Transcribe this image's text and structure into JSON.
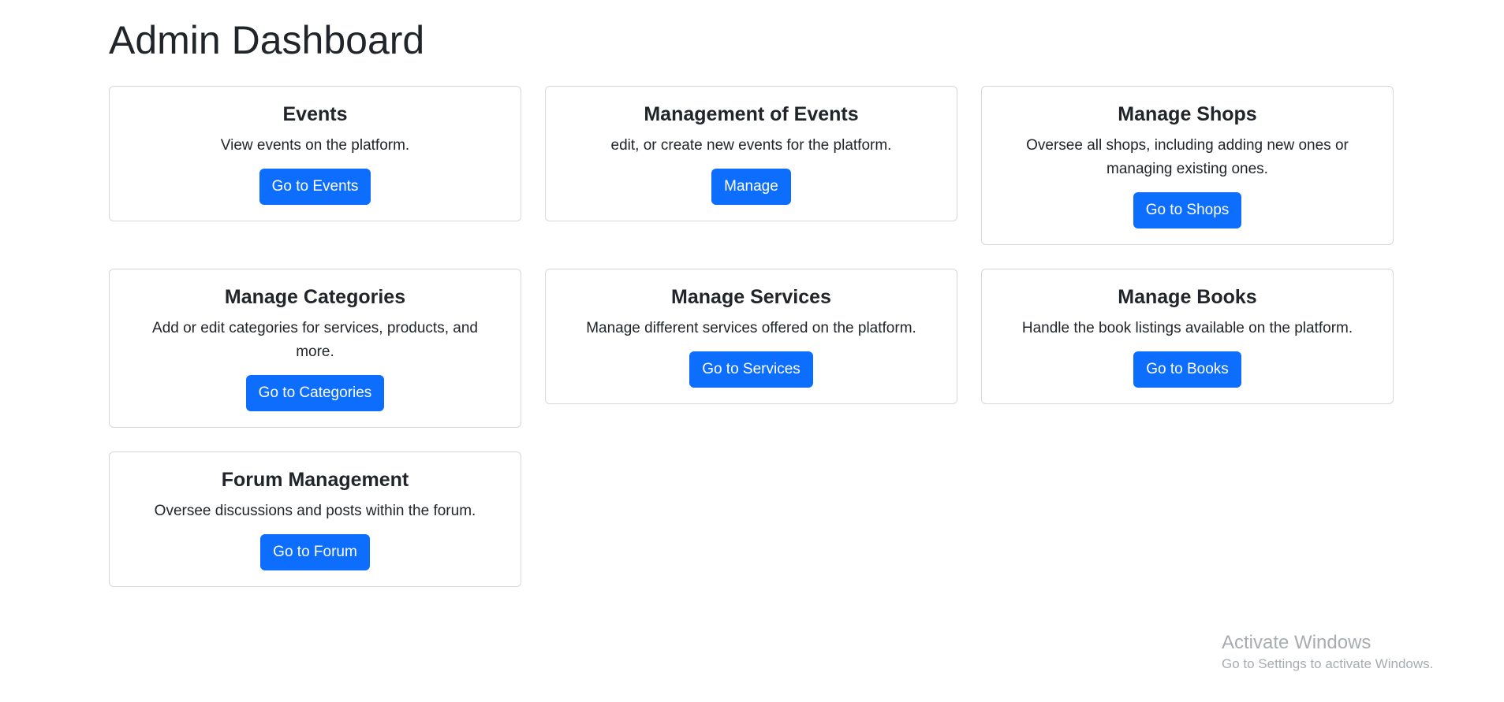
{
  "page": {
    "title": "Admin Dashboard"
  },
  "cards": [
    {
      "title": "Events",
      "text": "View events on the platform.",
      "button": "Go to Events"
    },
    {
      "title": "Management of Events",
      "text": "edit, or create new events for the platform.",
      "button": "Manage"
    },
    {
      "title": "Manage Shops",
      "text": "Oversee all shops, including adding new ones or managing existing ones.",
      "button": "Go to Shops"
    },
    {
      "title": "Manage Categories",
      "text": "Add or edit categories for services, products, and more.",
      "button": "Go to Categories"
    },
    {
      "title": "Manage Services",
      "text": "Manage different services offered on the platform.",
      "button": "Go to Services"
    },
    {
      "title": "Manage Books",
      "text": "Handle the book listings available on the platform.",
      "button": "Go to Books"
    },
    {
      "title": "Forum Management",
      "text": "Oversee discussions and posts within the forum.",
      "button": "Go to Forum"
    }
  ],
  "watermark": {
    "title": "Activate Windows",
    "subtitle": "Go to Settings to activate Windows."
  },
  "colors": {
    "primary": "#0d6efd",
    "text": "#212529",
    "border": "#d6d8db",
    "watermark": "#a8acb0"
  }
}
